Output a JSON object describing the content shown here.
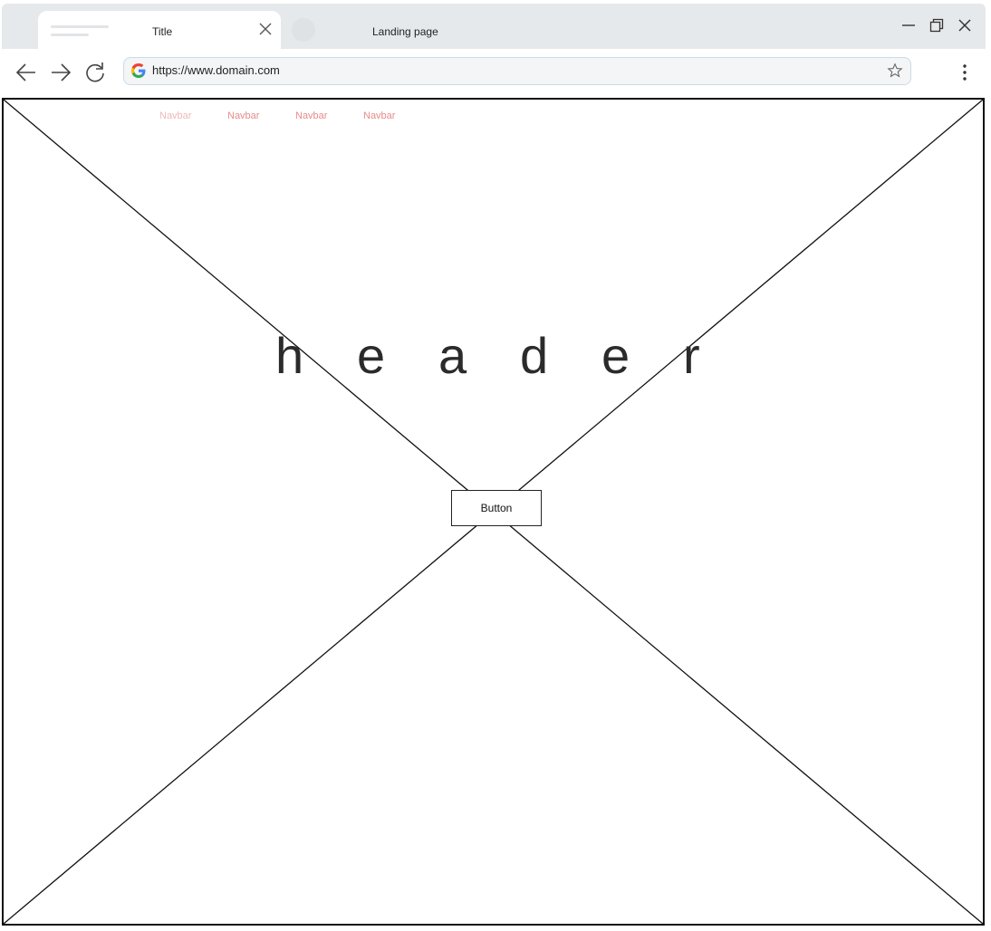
{
  "browser": {
    "tabs": [
      {
        "title": "Title",
        "active": true
      },
      {
        "title": "Landing page",
        "active": false
      }
    ],
    "address_bar": {
      "url": "https://www.domain.com"
    },
    "icons": {
      "back": "arrow-left-icon",
      "forward": "arrow-right-icon",
      "reload": "reload-icon",
      "bookmark": "star-icon",
      "menu": "kebab-menu-icon",
      "minimize": "minimize-icon",
      "maximize": "restore-icon",
      "close": "close-icon"
    }
  },
  "page": {
    "navbar": {
      "items": [
        "Navbar",
        "Navbar",
        "Navbar",
        "Navbar"
      ]
    },
    "header": {
      "letters": [
        "h",
        "e",
        "a",
        "d",
        "e",
        "r"
      ]
    },
    "button": {
      "label": "Button"
    }
  },
  "colors": {
    "navbar_text": "#e58b8b",
    "navbar_text_faded": "#efb8b8",
    "tabbar_bg": "#e6e9ec",
    "address_border": "#c8dbe9"
  }
}
